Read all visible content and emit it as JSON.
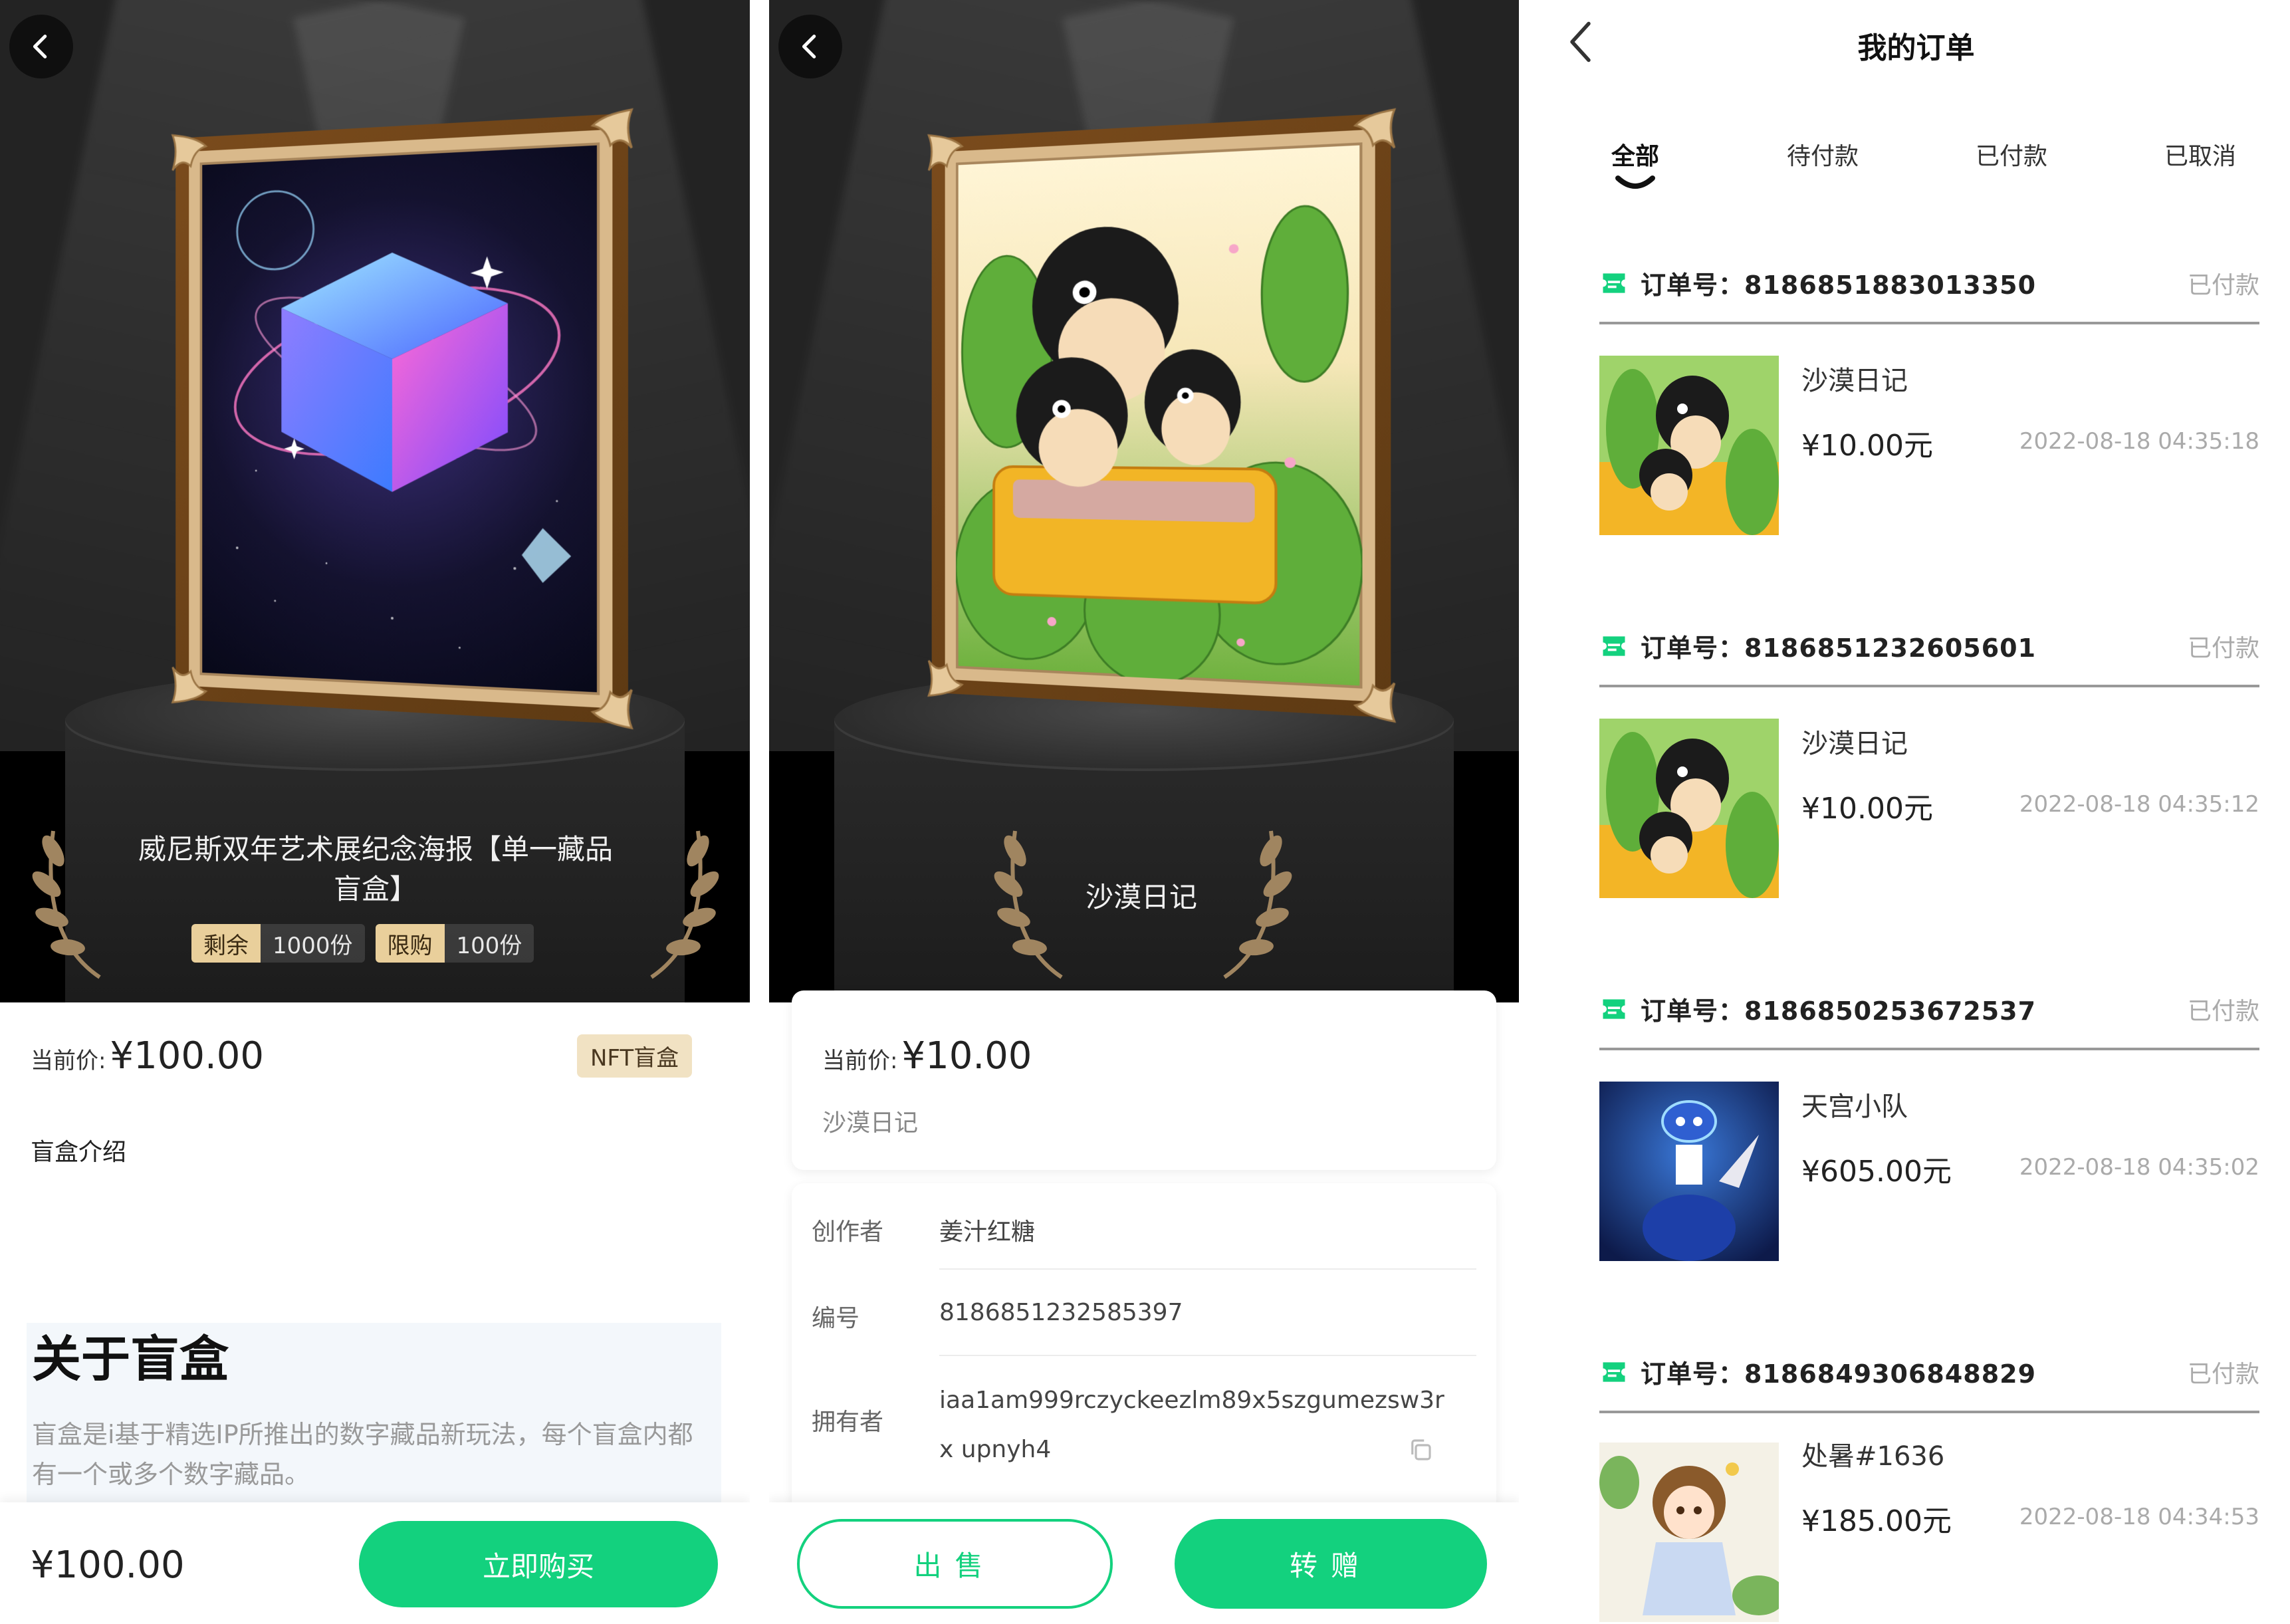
{
  "screen1": {
    "hero_title": "威尼斯双年艺术展纪念海报【单一藏品盲盒】",
    "badges": [
      {
        "key": "剩余",
        "value": "1000份"
      },
      {
        "key": "限购",
        "value": "100份"
      }
    ],
    "price_label": "当前价:",
    "price_value": "¥100.00",
    "tag": "NFT盲盒",
    "intro_label": "盲盒介绍",
    "about_title": "关于盲盒",
    "about_text": "盲盒是i基于精选IP所推出的数字藏品新玩法，每个盲盒内都有一个或多个数字藏品。",
    "bottom_price": "¥100.00",
    "buy_button": "立即购买"
  },
  "screen2": {
    "hero_title": "沙漠日记",
    "price_label": "当前价:",
    "price_value": "¥10.00",
    "item_name": "沙漠日记",
    "info": [
      {
        "key": "创作者",
        "value": "姜汁红糖"
      },
      {
        "key": "编号",
        "value": "8186851232585397"
      },
      {
        "key": "拥有者",
        "value": "iaa1am999rczyckeezlm89x5szgumezsw3rx upnyh4"
      }
    ],
    "sell_button": "出售",
    "gift_button": "转赠"
  },
  "screen3": {
    "title": "我的订单",
    "tabs": [
      "全部",
      "待付款",
      "已付款",
      "已取消"
    ],
    "active_tab": "全部",
    "order_prefix": "订单号:",
    "orders": [
      {
        "no": "订单号：8186851883013350",
        "status": "已付款",
        "name": "沙漠日记",
        "price": "¥10.00元",
        "time": "2022-08-18 04:35:18",
        "thumb": "cat"
      },
      {
        "no": "订单号：8186851232605601",
        "status": "已付款",
        "name": "沙漠日记",
        "price": "¥10.00元",
        "time": "2022-08-18 04:35:12",
        "thumb": "cat"
      },
      {
        "no": "订单号：8186850253672537",
        "status": "已付款",
        "name": "天宫小队",
        "price": "¥605.00元",
        "time": "2022-08-18 04:35:02",
        "thumb": "astronaut"
      },
      {
        "no": "订单号：8186849306848829",
        "status": "已付款",
        "name": "处暑#1636",
        "price": "¥185.00元",
        "time": "2022-08-18 04:34:53",
        "thumb": "girl"
      }
    ]
  },
  "colors": {
    "accent": "#13d17e",
    "stage": "#232323",
    "badge_key": "#e9cf9b",
    "tag_bg": "#f1e2c3"
  },
  "icons": [
    "back-arrow-icon",
    "copy-icon",
    "order-ticket-icon",
    "laurel-icon",
    "frame-corner-icon"
  ]
}
